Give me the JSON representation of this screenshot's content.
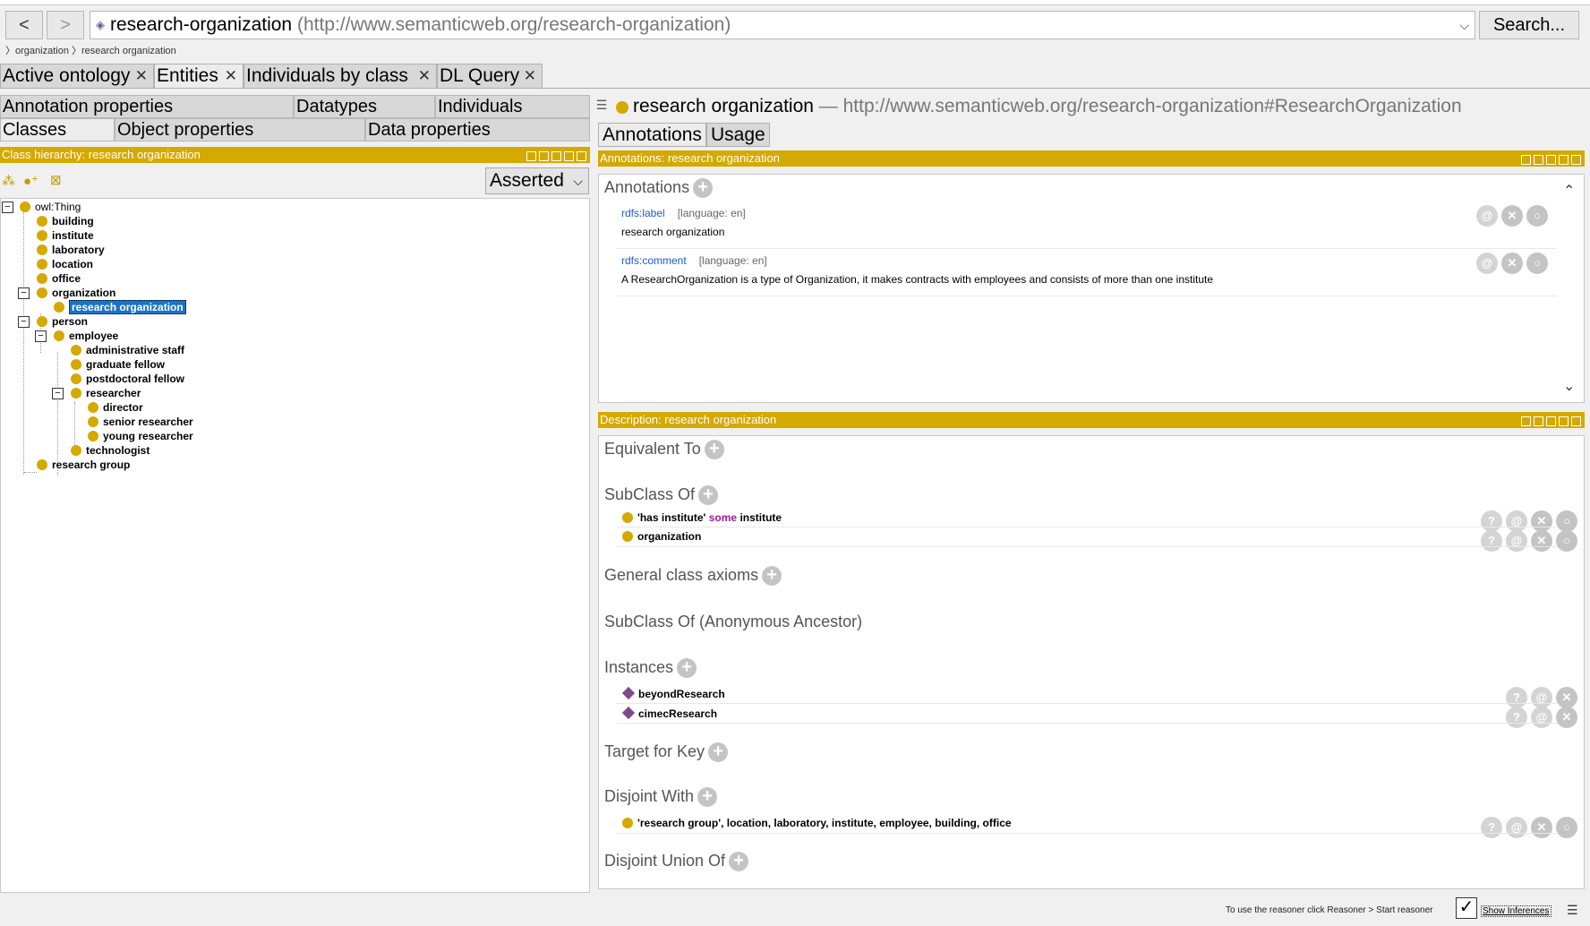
{
  "toolbar": {
    "back": "<",
    "forward": ">",
    "url_name": "research-organization",
    "url_iri": "(http://www.semanticweb.org/research-organization)",
    "search_label": "Search..."
  },
  "breadcrumb": [
    "organization",
    "research organization"
  ],
  "main_tabs": [
    {
      "label": "Active ontology"
    },
    {
      "label": "Entities"
    },
    {
      "label": "Individuals by class"
    },
    {
      "label": "DL Query"
    }
  ],
  "left_tabs": {
    "annotation_properties": "Annotation properties",
    "datatypes": "Datatypes",
    "individuals": "Individuals",
    "classes": "Classes",
    "object_properties": "Object properties",
    "data_properties": "Data properties"
  },
  "class_hierarchy": {
    "title": "Class hierarchy: research organization",
    "mode": "Asserted",
    "tree": [
      "owl:Thing",
      "building",
      "institute",
      "laboratory",
      "location",
      "office",
      "organization",
      "research organization",
      "person",
      "employee",
      "administrative staff",
      "graduate fellow",
      "postdoctoral fellow",
      "researcher",
      "director",
      "senior researcher",
      "young researcher",
      "technologist",
      "research group"
    ]
  },
  "entity": {
    "name": "research organization",
    "iri": "— http://www.semanticweb.org/research-organization#ResearchOrganization"
  },
  "right_tabs": [
    "Annotations",
    "Usage"
  ],
  "annotations_view": {
    "title": "Annotations: research organization",
    "header": "Annotations",
    "items": [
      {
        "property": "rdfs:label",
        "lang": "[language: en]",
        "value": "research organization"
      },
      {
        "property": "rdfs:comment",
        "lang": "[language: en]",
        "value": "A ResearchOrganization is a type of Organization, it makes contracts with employees and consists of more than one institute"
      }
    ]
  },
  "description_view": {
    "title": "Description: research organization",
    "sections": {
      "equivalent_to": "Equivalent To",
      "subclass_of": "SubClass Of",
      "general_class_axioms": "General class axioms",
      "subclass_anon": "SubClass Of (Anonymous Ancestor)",
      "instances": "Instances",
      "target_for_key": "Target for Key",
      "disjoint_with": "Disjoint With",
      "disjoint_union_of": "Disjoint Union Of"
    },
    "subclass_axioms": {
      "a_prop": "'has institute'",
      "a_kw": "some",
      "a_filler": "institute",
      "b": "organization"
    },
    "instances": [
      "beyondResearch",
      "cimecResearch"
    ],
    "disjoint_with": "'research group', location, laboratory, institute, employee, building, office"
  },
  "status": {
    "hint": "To use the reasoner click Reasoner > Start reasoner",
    "show_inferences": "Show Inferences",
    "show_inferences_checked": true
  },
  "colors": {
    "accent": "#d4a900",
    "selection": "#1a73c9",
    "keyword": "#a0189e",
    "individual": "#7a4c8c"
  }
}
